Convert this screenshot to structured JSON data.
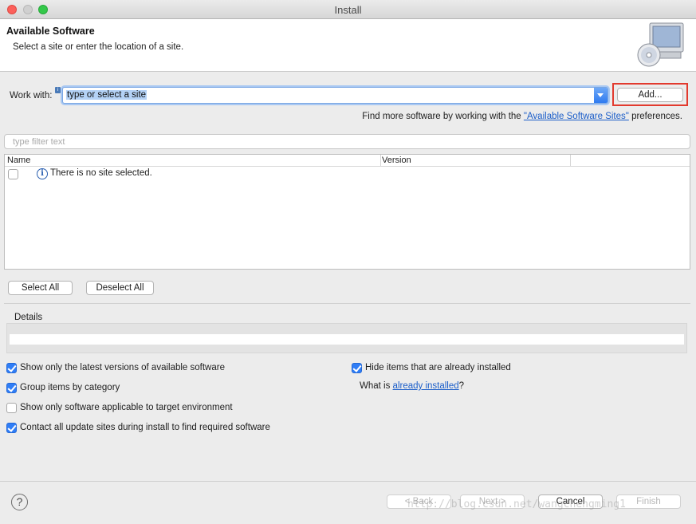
{
  "window": {
    "title": "Install"
  },
  "banner": {
    "title": "Available Software",
    "subtitle": "Select a site or enter the location of a site.",
    "icon": "monitor-cd-icon"
  },
  "work_with": {
    "label": "Work with:",
    "value": "type or select a site",
    "add_button": "Add...",
    "find_more_prefix": "Find more software by working with the",
    "find_more_link": "\"Available Software Sites\"",
    "find_more_suffix": "preferences."
  },
  "filter": {
    "placeholder": "type filter text"
  },
  "table": {
    "columns": [
      "Name",
      "Version"
    ],
    "rows": [
      {
        "checked": false,
        "icon": "info-icon",
        "text": "There is no site selected."
      }
    ]
  },
  "selection_buttons": {
    "select_all": "Select All",
    "deselect_all": "Deselect All"
  },
  "details": {
    "label": "Details"
  },
  "options": {
    "latest_versions": {
      "label": "Show only the latest versions of available software",
      "checked": true
    },
    "group_by_category": {
      "label": "Group items by category",
      "checked": true
    },
    "target_env": {
      "label": "Show only software applicable to target environment",
      "checked": false
    },
    "contact_sites": {
      "label": "Contact all update sites during install to find required software",
      "checked": true
    },
    "hide_installed": {
      "label": "Hide items that are already installed",
      "checked": true
    },
    "what_is_prefix": "What is",
    "what_is_link": "already installed",
    "what_is_suffix": "?"
  },
  "footer": {
    "help": "?",
    "back": "< Back",
    "next": "Next >",
    "cancel": "Cancel",
    "finish": "Finish"
  },
  "watermark": "http://blog.csdn.net/wangchengming1"
}
